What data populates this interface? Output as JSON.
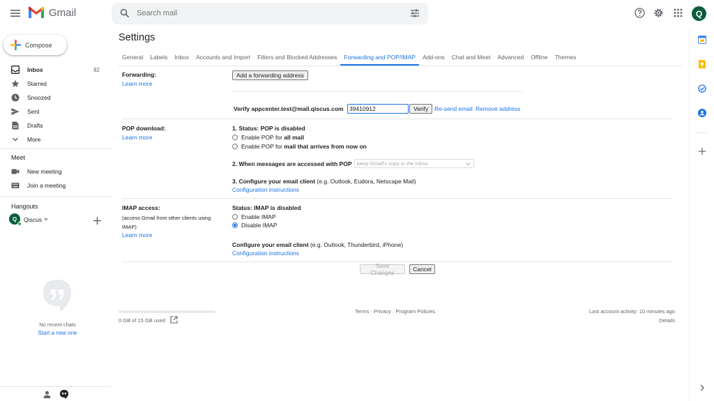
{
  "header": {
    "app_name": "Gmail",
    "search_placeholder": "Search mail",
    "avatar_initial": "Q"
  },
  "sidebar": {
    "compose_label": "Compose",
    "items": [
      {
        "label": "Inbox",
        "count": "82",
        "icon": "inbox-icon"
      },
      {
        "label": "Starred",
        "count": "",
        "icon": "star-icon"
      },
      {
        "label": "Snoozed",
        "count": "",
        "icon": "clock-icon"
      },
      {
        "label": "Sent",
        "count": "",
        "icon": "send-icon"
      },
      {
        "label": "Drafts",
        "count": "",
        "icon": "draft-icon"
      },
      {
        "label": "More",
        "count": "",
        "icon": "chevron-down-icon"
      }
    ],
    "meet": {
      "title": "Meet",
      "items": [
        {
          "label": "New meeting",
          "icon": "video-icon"
        },
        {
          "label": "Join a meeting",
          "icon": "keyboard-icon"
        }
      ]
    },
    "hangouts": {
      "title": "Hangouts",
      "user_initial": "Q",
      "user_name": "Qiscus",
      "no_chats": "No recent chats",
      "start_link": "Start a new one"
    }
  },
  "settings": {
    "title": "Settings",
    "tabs": [
      "General",
      "Labels",
      "Inbox",
      "Accounts and Import",
      "Filters and Blocked Addresses",
      "Forwarding and POP/IMAP",
      "Add-ons",
      "Chat and Meet",
      "Advanced",
      "Offline",
      "Themes"
    ],
    "active_tab": 5,
    "forwarding": {
      "label": "Forwarding:",
      "learn_more": "Learn more",
      "add_button": "Add a forwarding address",
      "verify_text": "Verify appcenter.test@mail.qiscus.com",
      "verify_code": "39410912",
      "verify_button": "Verify",
      "resend_link": "Re-send email",
      "remove_link": "Remove address"
    },
    "pop": {
      "label": "POP download:",
      "learn_more": "Learn more",
      "status": "1. Status: POP is disabled",
      "option_all_prefix": "Enable POP for ",
      "option_all_bold": "all mail",
      "option_now_prefix": "Enable POP for ",
      "option_now_bold": "mail that arrives from now on",
      "step2": "2. When messages are accessed with POP",
      "step2_select": "keep Gmail's copy in the Inbox",
      "step3_bold": "3. Configure your email client",
      "step3_rest": " (e.g. Outlook, Eudora, Netscape Mail)",
      "config_link": "Configuration instructions"
    },
    "imap": {
      "label": "IMAP access:",
      "sub": "(access Gmail from other clients using IMAP)",
      "learn_more": "Learn more",
      "status": "Status: IMAP is disabled",
      "enable": "Enable IMAP",
      "disable": "Disable IMAP",
      "selected": "disable",
      "config_bold": "Configure your email client",
      "config_rest": " (e.g. Outlook, Thunderbird, iPhone)",
      "config_link": "Configuration instructions"
    },
    "save_button": "Save Changes",
    "cancel_button": "Cancel"
  },
  "footer": {
    "storage": "0 GB of 15 GB used",
    "storage_fraction": 0.0,
    "links": "Terms · Privacy · Program Policies",
    "last_activity": "Last account activity: 10 minutes ago",
    "details": "Details"
  },
  "colors": {
    "accent": "#1a73e8",
    "avatar": "#0b5c3c"
  }
}
